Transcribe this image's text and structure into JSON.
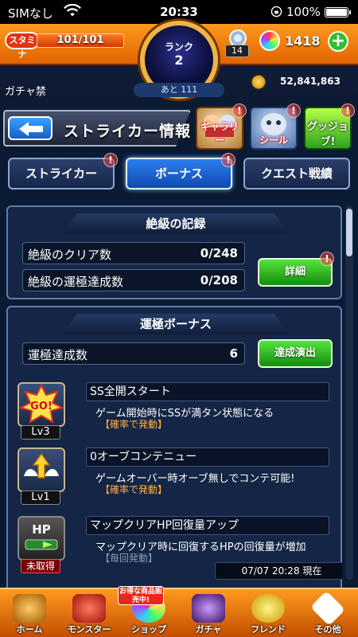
{
  "status_bar": {
    "carrier": "SIMなし",
    "time": "20:33",
    "battery": "100%"
  },
  "hud": {
    "stamina_label": "スタミナ",
    "stamina_value": "101/101",
    "stamina_fraction": 1.0,
    "rank_label": "ランク",
    "rank_value": "2",
    "rank_next": "あと 111",
    "orb_count": "14",
    "gem_count": "1418",
    "gacha_ban": "ガチャ禁",
    "coins": "52,841,863"
  },
  "header": {
    "title": "ストライカー情報",
    "shortcuts": [
      {
        "label": "ギャラリー",
        "icon": "gallery-icon"
      },
      {
        "label": "シール",
        "icon": "seal-icon"
      },
      {
        "label": "グッジョブ!",
        "icon": "goodjob-icon"
      }
    ]
  },
  "tabs": [
    {
      "label": "ストライカー",
      "active": false
    },
    {
      "label": "ボーナス",
      "active": true
    },
    {
      "label": "クエスト戦績",
      "active": false
    }
  ],
  "extreme_record": {
    "heading": "絶級の記録",
    "rows": [
      {
        "label": "絶級のクリア数",
        "value": "0/248"
      },
      {
        "label": "絶級の運極達成数",
        "value": "0/208"
      }
    ],
    "detail_button": "詳細"
  },
  "luck_bonus": {
    "heading": "運極ボーナス",
    "count_label": "運極達成数",
    "count_value": "6",
    "show_button": "達成演出",
    "items": [
      {
        "name": "SS全開スタート",
        "desc": "ゲーム開始時にSSが満タン状態になる",
        "trigger": "【確率で発動】",
        "level": "Lv3",
        "icon_text": "GO!"
      },
      {
        "name": "0オーブコンテニュー",
        "desc": "ゲームオーバー時オーブ無しでコンテ可能!",
        "trigger": "【確率で発動】",
        "level": "Lv1",
        "icon_text": ""
      },
      {
        "name": "マップクリアHP回復量アップ",
        "desc": "マップクリア時に回復するHPの回復量が増加",
        "trigger": "【毎回発動】",
        "level": "未取得",
        "icon_text": "HP"
      }
    ]
  },
  "timestamp": "07/07 20:28 現在",
  "bottom_nav": [
    {
      "label": "ホーム"
    },
    {
      "label": "モンスター"
    },
    {
      "label": "ショップ"
    },
    {
      "label": "ガチャ"
    },
    {
      "label": "フレンド"
    },
    {
      "label": "その他"
    }
  ],
  "deal_tag": "お得な商品販売中!",
  "colors": {
    "accent_orange": "#ff9a1f",
    "tab_active": "#2b7ff0",
    "green_button": "#54e43e",
    "trigger_text": "#ffb04a"
  }
}
